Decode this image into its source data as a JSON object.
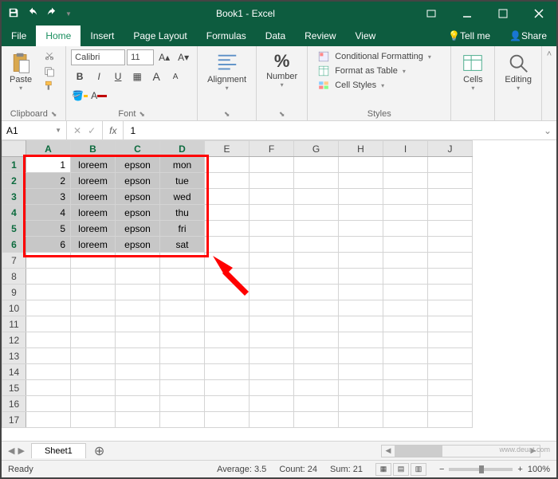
{
  "title": "Book1 - Excel",
  "menu": {
    "file": "File",
    "home": "Home",
    "insert": "Insert",
    "pagelayout": "Page Layout",
    "formulas": "Formulas",
    "data": "Data",
    "review": "Review",
    "view": "View",
    "tellme": "Tell me",
    "share": "Share"
  },
  "ribbon": {
    "clipboard": {
      "paste": "Paste",
      "label": "Clipboard"
    },
    "font": {
      "name": "Calibri",
      "size": "11",
      "label": "Font"
    },
    "alignment": {
      "btn": "Alignment"
    },
    "number": {
      "btn": "Number",
      "format": "%"
    },
    "styles": {
      "cf": "Conditional Formatting",
      "fat": "Format as Table",
      "cs": "Cell Styles",
      "label": "Styles"
    },
    "cells": {
      "btn": "Cells"
    },
    "editing": {
      "btn": "Editing"
    }
  },
  "namebox": "A1",
  "formula": "1",
  "columns": [
    "A",
    "B",
    "C",
    "D",
    "E",
    "F",
    "G",
    "H",
    "I",
    "J"
  ],
  "rows": [
    "1",
    "2",
    "3",
    "4",
    "5",
    "6",
    "7",
    "8",
    "9",
    "10",
    "11",
    "12",
    "13",
    "14",
    "15",
    "16",
    "17"
  ],
  "cells": {
    "r1": {
      "a": "1",
      "b": "loreem",
      "c": "epson",
      "d": "mon"
    },
    "r2": {
      "a": "2",
      "b": "loreem",
      "c": "epson",
      "d": "tue"
    },
    "r3": {
      "a": "3",
      "b": "loreem",
      "c": "epson",
      "d": "wed"
    },
    "r4": {
      "a": "4",
      "b": "loreem",
      "c": "epson",
      "d": "thu"
    },
    "r5": {
      "a": "5",
      "b": "loreem",
      "c": "epson",
      "d": "fri"
    },
    "r6": {
      "a": "6",
      "b": "loreem",
      "c": "epson",
      "d": "sat"
    }
  },
  "sheet": "Sheet1",
  "status": {
    "ready": "Ready",
    "avg": "Average: 3.5",
    "count": "Count: 24",
    "sum": "Sum: 21",
    "zoom": "100%"
  },
  "watermark": "www.deuat.com"
}
